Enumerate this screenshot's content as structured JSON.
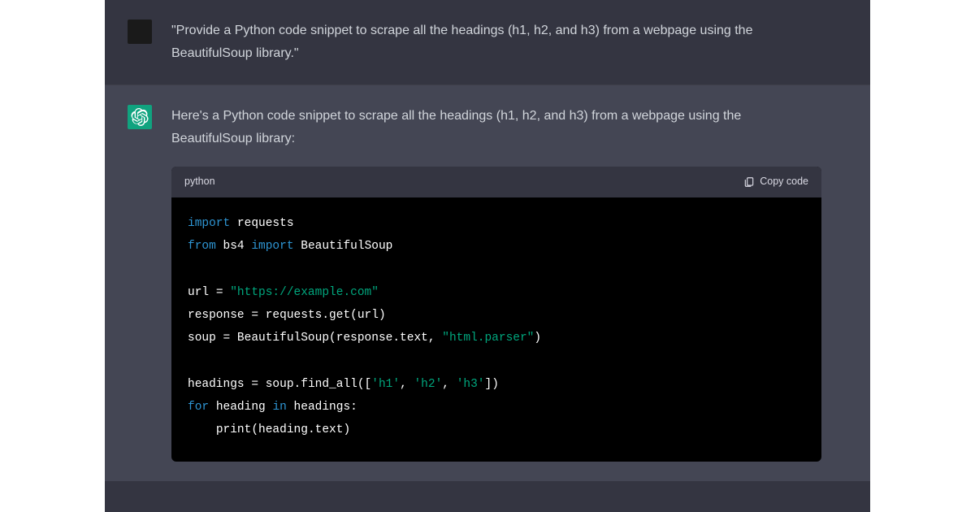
{
  "user": {
    "message": "\"Provide a Python code snippet to scrape all the headings (h1, h2, and h3) from a webpage using the BeautifulSoup library.\""
  },
  "assistant": {
    "intro": "Here's a Python code snippet to scrape all the headings (h1, h2, and h3) from a webpage using the BeautifulSoup library:",
    "code_lang": "python",
    "copy_label": "Copy code",
    "code": {
      "kw_import": "import",
      "mod_requests": "requests",
      "kw_from": "from",
      "mod_bs4": "bs4",
      "kw_import2": "import",
      "mod_bs": "BeautifulSoup",
      "var_url": "url",
      "op_eq": "=",
      "str_url": "\"https://example.com\"",
      "var_response": "response",
      "call_get": "requests.get(url)",
      "var_soup": "soup",
      "call_bs": "BeautifulSoup(response.text,",
      "str_parser": "\"html.parser\"",
      "close_paren": ")",
      "var_headings": "headings",
      "call_findall_open": "soup.find_all([",
      "str_h1": "'h1'",
      "comma1": ",",
      "str_h2": "'h2'",
      "comma2": ",",
      "str_h3": "'h3'",
      "close_list": "])",
      "kw_for": "for",
      "var_heading": "heading",
      "kw_in": "in",
      "var_headings2": "headings:",
      "fn_print": "print",
      "call_print_arg": "(heading.text)"
    }
  }
}
